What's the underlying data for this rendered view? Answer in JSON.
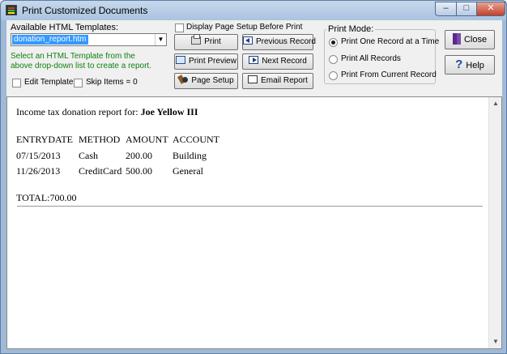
{
  "window": {
    "title": "Print Customized Documents",
    "controls": {
      "minimize": "–",
      "maximize": "□",
      "close": "✕"
    }
  },
  "templates": {
    "label": "Available HTML Templates:",
    "selected": "donation_report.htm",
    "hint": "Select an HTML Template from the above drop-down list to create a report.",
    "edit_template_label": "Edit Template",
    "skip_items_label": "Skip Items = 0"
  },
  "page_setup_checkbox": "Display Page Setup Before Print",
  "buttons": {
    "print": "Print",
    "print_preview": "Print Preview",
    "page_setup": "Page Setup",
    "previous_record": "Previous Record",
    "next_record": "Next Record",
    "email_report": "Email Report",
    "close": "Close",
    "help": "Help"
  },
  "print_mode": {
    "title": "Print Mode:",
    "options": [
      "Print One Record at a Time",
      "Print All Records",
      "Print From Current Record"
    ],
    "selected_index": 0
  },
  "report": {
    "heading_prefix": "Income tax donation report for: ",
    "person": "Joe Yellow III",
    "columns": [
      "ENTRYDATE",
      "METHOD",
      "AMOUNT",
      "ACCOUNT"
    ],
    "rows": [
      [
        "07/15/2013",
        "Cash",
        "200.00",
        "Building"
      ],
      [
        "11/26/2013",
        "CreditCard",
        "500.00",
        "General"
      ]
    ],
    "total": "TOTAL:700.00"
  },
  "colors": {
    "hint_text": "#108010",
    "selection": "#3399ff"
  }
}
